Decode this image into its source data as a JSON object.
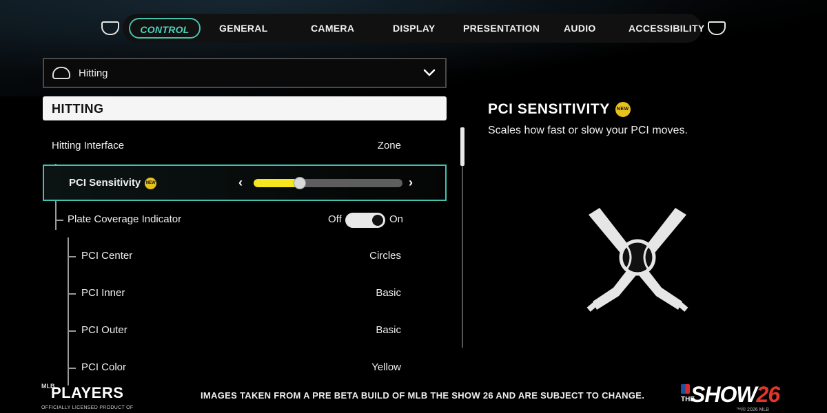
{
  "nav": {
    "tabs": [
      {
        "label": "CONTROL",
        "active": true
      },
      {
        "label": "GENERAL"
      },
      {
        "label": "CAMERA"
      },
      {
        "label": "DISPLAY"
      },
      {
        "label": "PRESENTATION"
      },
      {
        "label": "AUDIO"
      },
      {
        "label": "ACCESSIBILITY"
      }
    ],
    "left_bumper_icon": "lb-bumper-icon",
    "right_bumper_icon": "rb-bumper-icon"
  },
  "dropdown": {
    "label": "Hitting",
    "icon": "batting-helmet-icon"
  },
  "section": {
    "title": "HITTING"
  },
  "settings": {
    "hitting_interface": {
      "label": "Hitting Interface",
      "value": "Zone"
    },
    "pci_sensitivity": {
      "label": "PCI Sensitivity",
      "badge": "NEW",
      "level": 0.31
    },
    "plate_coverage": {
      "label": "Plate Coverage Indicator",
      "off_label": "Off",
      "on_label": "On",
      "state": "on"
    },
    "pci_center": {
      "label": "PCI Center",
      "value": "Circles"
    },
    "pci_inner": {
      "label": "PCI Inner",
      "value": "Basic"
    },
    "pci_outer": {
      "label": "PCI Outer",
      "value": "Basic"
    },
    "pci_color": {
      "label": "PCI Color",
      "value": "Yellow"
    }
  },
  "detail": {
    "title": "PCI SENSITIVITY",
    "badge": "NEW",
    "description": "Scales how fast or slow your PCI moves.",
    "icon": "crossed-bats-ball-icon"
  },
  "footer": {
    "players_mlb": "MLB",
    "players_name": "PLAYERS",
    "players_sub": "OFFICIALLY LICENSED PRODUCT OF",
    "disclaimer": "IMAGES TAKEN FROM A PRE BETA BUILD OF MLB THE SHOW 26 AND ARE SUBJECT TO CHANGE.",
    "show_the": "THE",
    "show_name": "SHOW",
    "show_num": "26",
    "show_copy": "™/© 2026 MLB"
  },
  "colors": {
    "accent": "#43c2b0",
    "slider_fill": "#f5e61f",
    "badge": "#e9c11c"
  }
}
